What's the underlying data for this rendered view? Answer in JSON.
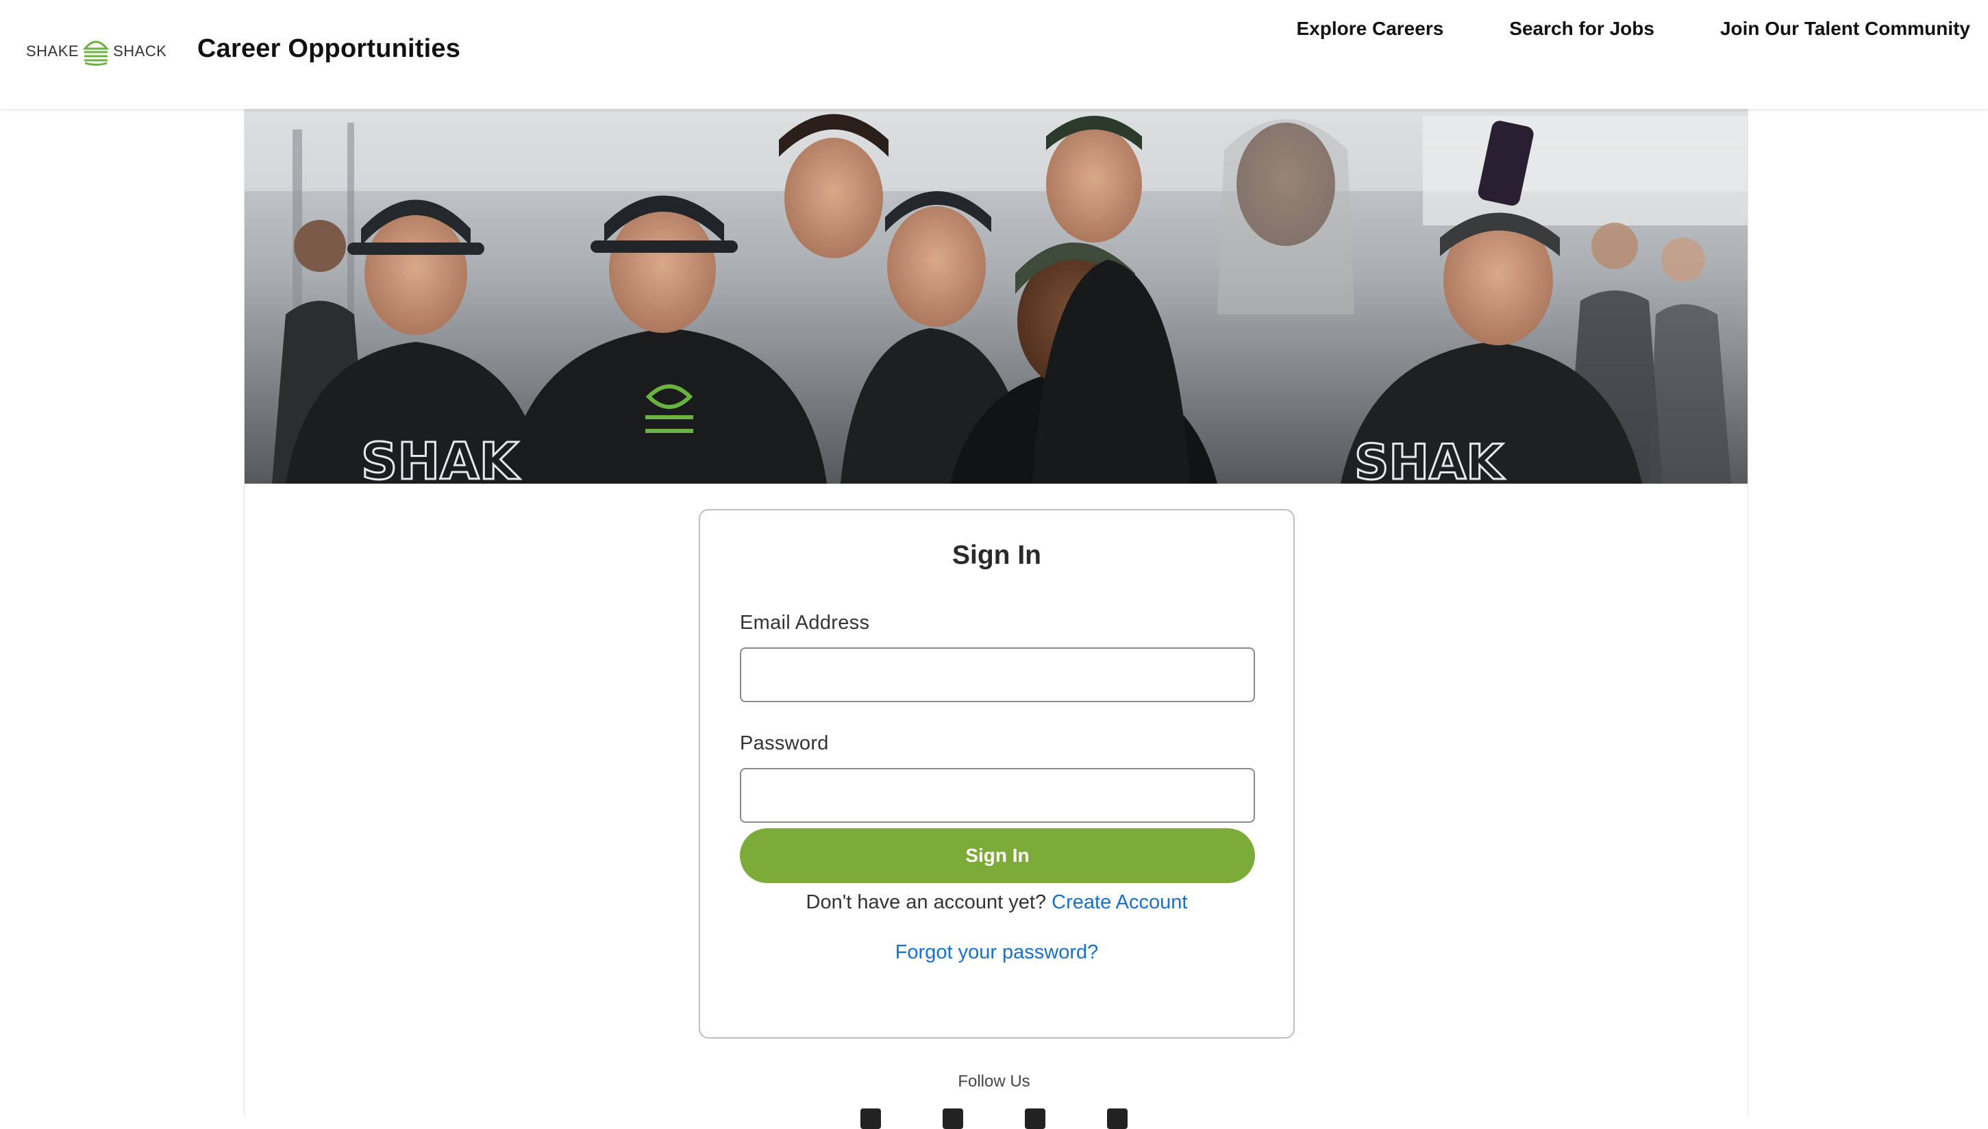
{
  "header": {
    "logo_left": "SHAKE",
    "logo_right": "SHACK",
    "title": "Career Opportunities",
    "nav": [
      {
        "label": "Explore Careers"
      },
      {
        "label": "Search for Jobs"
      },
      {
        "label": "Join Our Talent Community"
      }
    ]
  },
  "hero": {
    "icon": "team-photo"
  },
  "signin": {
    "heading": "Sign In",
    "email_label": "Email Address",
    "email_value": "",
    "password_label": "Password",
    "password_value": "",
    "button_label": "Sign In",
    "no_account_text": "Don't have an account yet?",
    "create_account_link": "Create Account",
    "forgot_link": "Forgot your password?"
  },
  "footer": {
    "follow_label": "Follow Us",
    "social_icons": [
      "facebook-icon",
      "twitter-icon",
      "linkedin-icon",
      "instagram-icon"
    ]
  },
  "colors": {
    "accent": "#7dab3a",
    "link": "#1a6fc9",
    "logo_burger": "#6bb33f"
  }
}
